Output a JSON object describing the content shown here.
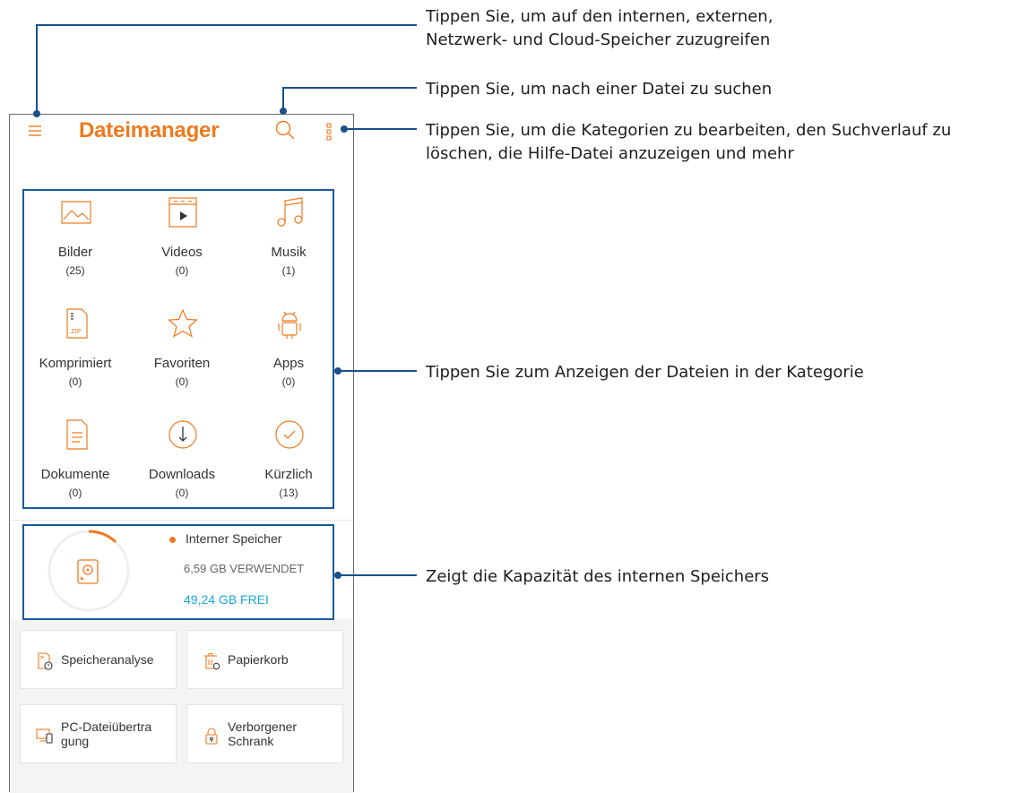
{
  "app": {
    "title": "Dateimanager"
  },
  "categories": [
    {
      "label": "Bilder",
      "count": "(25)",
      "icon": "image-icon"
    },
    {
      "label": "Videos",
      "count": "(0)",
      "icon": "video-icon"
    },
    {
      "label": "Musik",
      "count": "(1)",
      "icon": "music-icon"
    },
    {
      "label": "Komprimiert",
      "count": "(0)",
      "icon": "zip-icon"
    },
    {
      "label": "Favoriten",
      "count": "(0)",
      "icon": "star-icon"
    },
    {
      "label": "Apps",
      "count": "(0)",
      "icon": "android-icon"
    },
    {
      "label": "Dokumente",
      "count": "(0)",
      "icon": "document-icon"
    },
    {
      "label": "Downloads",
      "count": "(0)",
      "icon": "download-icon"
    },
    {
      "label": "Kürzlich",
      "count": "(13)",
      "icon": "recent-check-icon"
    }
  ],
  "storage": {
    "name": "Interner Speicher",
    "used": "6,59 GB VERWENDET",
    "free": "49,24 GB FREI",
    "used_fraction": 0.12
  },
  "tools": [
    {
      "label": "Speicheranalyse",
      "icon": "storage-analysis-icon"
    },
    {
      "label": "Papierkorb",
      "icon": "trash-icon"
    },
    {
      "label": "PC-Dateiübertra\ngung",
      "icon": "pc-transfer-icon"
    },
    {
      "label": "Verborgener\nSchrank",
      "icon": "lock-icon"
    }
  ],
  "callouts": {
    "menu": "Tippen Sie, um auf den internen, externen,\nNetzwerk- und Cloud-Speicher zuzugreifen",
    "search": "Tippen Sie, um nach einer Datei zu suchen",
    "more": "Tippen Sie, um die Kategorien zu bearbeiten, den Suchverlauf zu\nlöschen, die Hilfe-Datei anzuzeigen und mehr",
    "categories": "Tippen Sie zum Anzeigen der Dateien in der Kategorie",
    "storage": "Zeigt die Kapazität des internen Speichers"
  },
  "colors": {
    "accent": "#ee7a1f",
    "free": "#1aa5d8",
    "callout": "#1a4f88"
  }
}
